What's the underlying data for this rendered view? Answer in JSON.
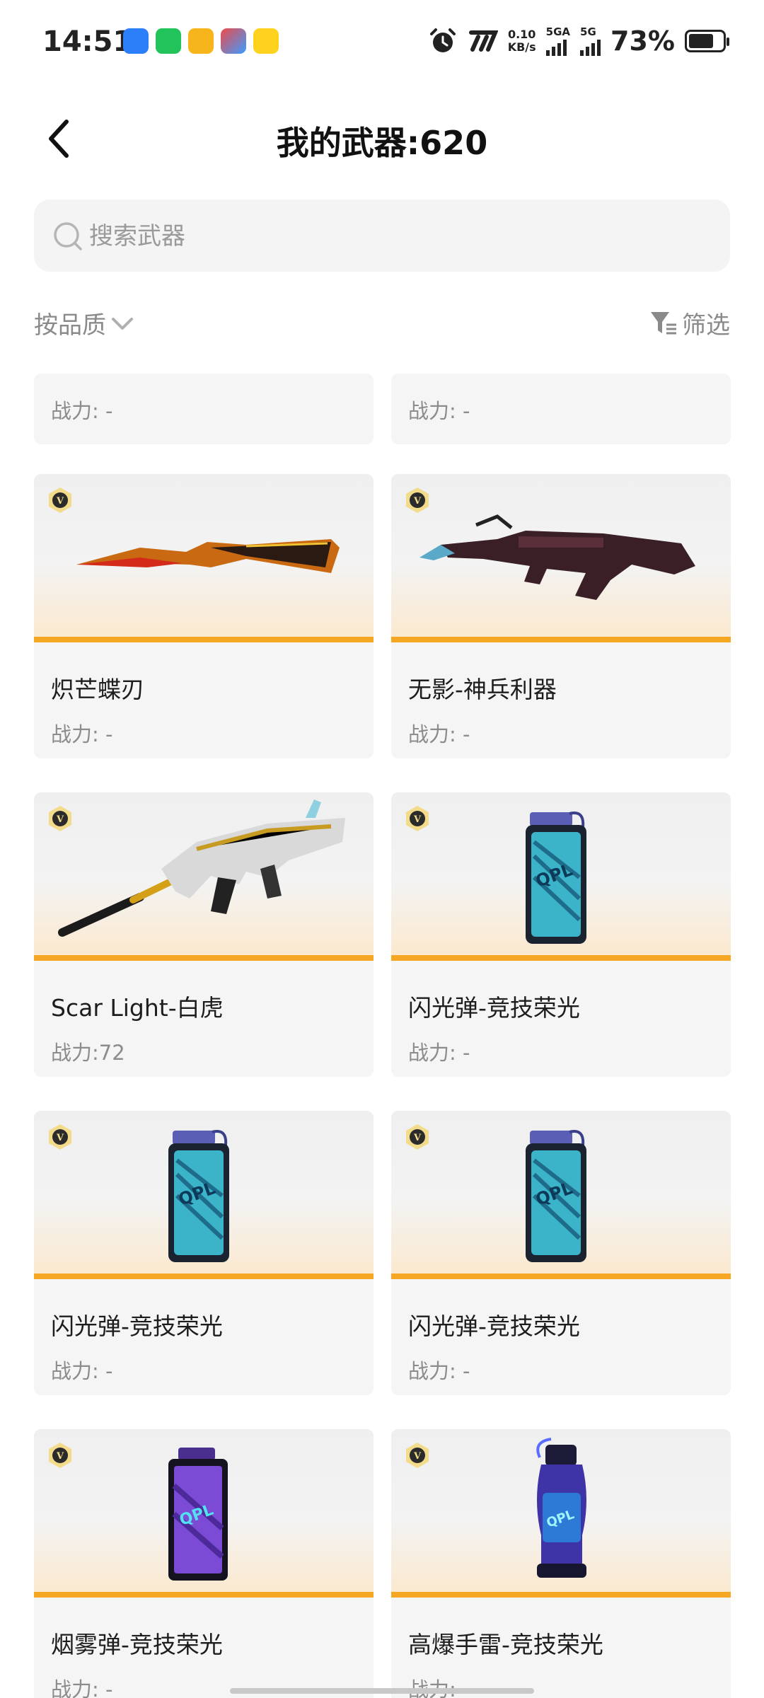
{
  "status_bar": {
    "time": "14:51",
    "net_speed_value": "0.10",
    "net_speed_unit": "KB/s",
    "sim1_label": "5GA",
    "sim2_label": "5G",
    "battery_percent": "73%",
    "battery_level": 0.73,
    "app_icons": [
      "app-blue-icon",
      "wechat-icon",
      "app-yellow-icon",
      "app-colorful-icon",
      "app-yellow-2-icon"
    ]
  },
  "header": {
    "title": "我的武器:620"
  },
  "search": {
    "placeholder": "搜索武器",
    "value": ""
  },
  "toolbar": {
    "sort_label": "按品质",
    "filter_label": "筛选"
  },
  "colors": {
    "accent_bar": "#f5a623",
    "badge_gold": "#f2dc8c"
  },
  "weapons": [
    {
      "name": "",
      "power": "战力: -",
      "partial": true
    },
    {
      "name": "",
      "power": "战力: -",
      "partial": true
    },
    {
      "name": "炽芒蝶刃",
      "power": "战力: -",
      "art": "knife"
    },
    {
      "name": "无影-神兵利器",
      "power": "战力: -",
      "art": "rifle"
    },
    {
      "name": "Scar Light-白虎",
      "power": "战力:72",
      "art": "scar"
    },
    {
      "name": "闪光弹-竞技荣光",
      "power": "战力: -",
      "art": "flash"
    },
    {
      "name": "闪光弹-竞技荣光",
      "power": "战力: -",
      "art": "flash"
    },
    {
      "name": "闪光弹-竞技荣光",
      "power": "战力: -",
      "art": "flash"
    },
    {
      "name": "烟雾弹-竞技荣光",
      "power": "战力: -",
      "art": "smoke"
    },
    {
      "name": "高爆手雷-竞技荣光",
      "power": "战力: -",
      "art": "grenade"
    }
  ]
}
